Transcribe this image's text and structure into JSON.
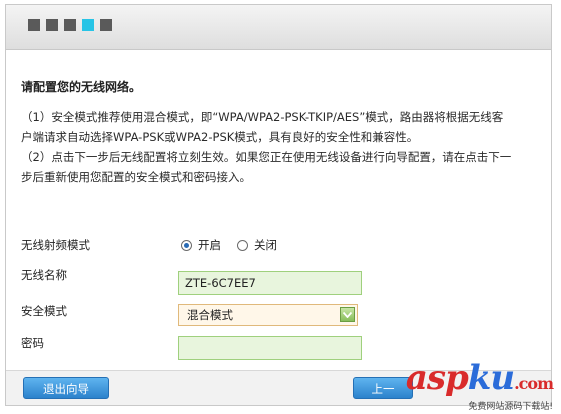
{
  "steps": {
    "count": 5,
    "active_index": 3
  },
  "content": {
    "title": "请配置您的无线网络。",
    "para1_line1": "（1）安全模式推荐使用混合模式，即“WPA/WPA2-PSK-TKIP/AES”模式，路由器将根据无线客",
    "para1_line2": "户端请求自动选择WPA-PSK或WPA2-PSK模式，具有良好的安全性和兼容性。",
    "para2_line1": "（2）点击下一步后无线配置将立刻生效。如果您正在使用无线设备进行向导配置，请在点击下一",
    "para2_line2": "步后重新使用您配置的安全模式和密码接入。"
  },
  "form": {
    "radio_mode": {
      "label": "无线射频模式",
      "on_label": "开启",
      "off_label": "关闭",
      "selected": "on"
    },
    "ssid": {
      "label": "无线名称",
      "value": "ZTE-6C7EE7"
    },
    "security": {
      "label": "安全模式",
      "selected": "混合模式"
    },
    "password": {
      "label": "密码",
      "value": ""
    }
  },
  "footer": {
    "exit_label": "退出向导",
    "prev_label": "上一"
  },
  "watermark": {
    "logo_a": "asp",
    "logo_k": "ku",
    "logo_com": ".com",
    "sub": "免费网站源码下载站!"
  }
}
